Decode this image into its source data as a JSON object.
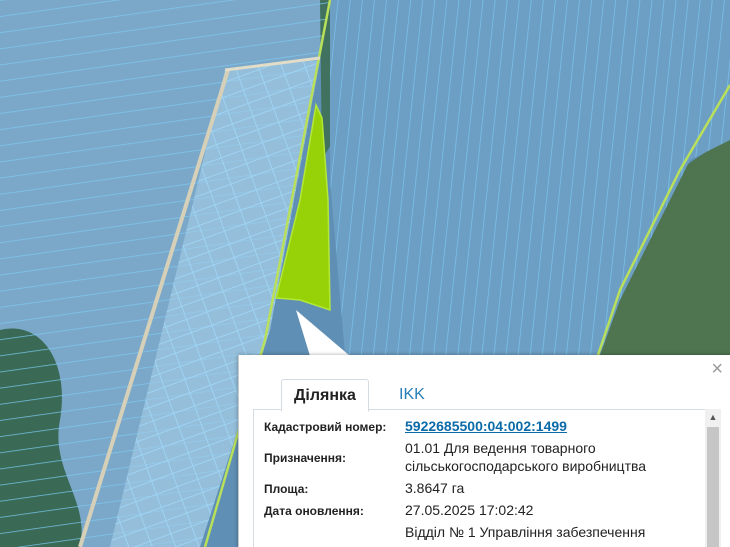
{
  "map": {
    "colors": {
      "parcel_overlay": "#7fb6df",
      "parcel_outline": "#7ccaf5",
      "selected_parcel": "#9ad600",
      "boundary_line": "#b9e05a",
      "forest": "#2c5a2a",
      "field": "#6f8a56"
    },
    "selected_parcel_label": "5922685500:04:002:1499"
  },
  "popup": {
    "close_icon": "×",
    "tabs": [
      {
        "label": "Ділянка",
        "active": true
      },
      {
        "label": "IKK",
        "active": false
      }
    ],
    "rows": [
      {
        "label": "Кадастровий номер:",
        "value": "5922685500:04:002:1499",
        "link": true
      },
      {
        "label": "Призначення:",
        "value_line1": "01.01 Для ведення товарного",
        "value_line2": "сільськогосподарського виробництва"
      },
      {
        "label": "Площа:",
        "value": "3.8647 га"
      },
      {
        "label": "Дата оновлення:",
        "value": "27.05.2025 17:02:42"
      },
      {
        "label": "",
        "value": "Відділ № 1 Управління забезпечення"
      }
    ],
    "scroll_up_icon": "▲"
  }
}
